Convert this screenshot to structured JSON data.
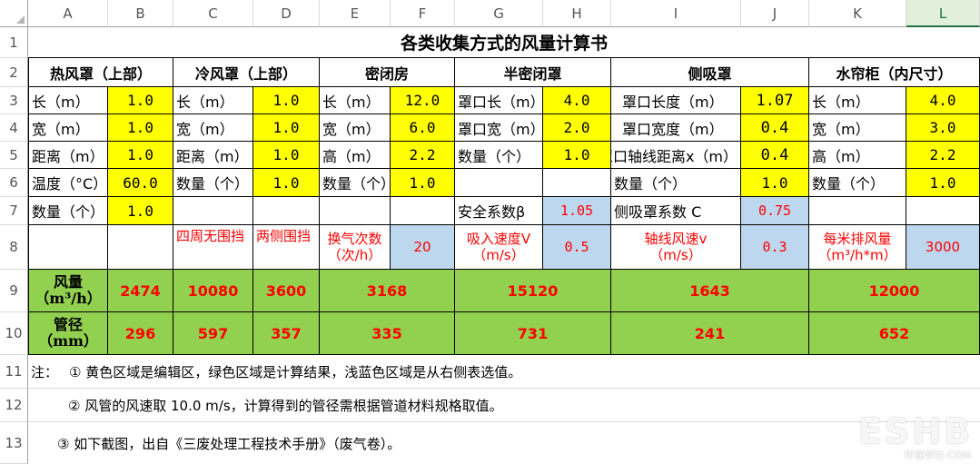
{
  "columns": [
    "A",
    "B",
    "C",
    "D",
    "E",
    "F",
    "G",
    "H",
    "I",
    "J",
    "K",
    "L"
  ],
  "rows": [
    "1",
    "2",
    "3",
    "4",
    "5",
    "6",
    "7",
    "8",
    "9",
    "10",
    "11",
    "12",
    "13"
  ],
  "selected_column": "L",
  "title": "各类收集方式的风量计算书",
  "sections": {
    "hot_hood": "热风罩（上部）",
    "cold_hood": "冷风罩（上部）",
    "closed_room": "密闭房",
    "semi_closed": "半密闭罩",
    "side_suction": "侧吸罩",
    "water_curtain": "水帘柜（内尺寸）"
  },
  "hot_hood": {
    "length_label": "长（m）",
    "length": "1.0",
    "width_label": "宽（m）",
    "width": "1.0",
    "distance_label": "距离（m）",
    "distance": "1.0",
    "temp_label": "温度（°C）",
    "temp": "60.0",
    "count_label": "数量（个）",
    "count": "1.0"
  },
  "cold_hood": {
    "length_label": "长（m）",
    "length": "1.0",
    "width_label": "宽（m）",
    "width": "1.0",
    "distance_label": "距离（m）",
    "distance": "1.0",
    "count_label": "数量（个）",
    "count": "1.0",
    "note_four_sides": "四周无围挡",
    "note_two_sides": "两侧围挡"
  },
  "closed_room": {
    "length_label": "长（m）",
    "length": "12.0",
    "width_label": "宽（m）",
    "width": "6.0",
    "height_label": "高（m）",
    "height": "2.2",
    "count_label": "数量（个）",
    "count": "1.0",
    "air_change_label": "换气次数（次/h）",
    "air_change": "20"
  },
  "semi_closed": {
    "length_label": "罩口长（m）",
    "length": "4.0",
    "width_label": "罩口宽（m）",
    "width": "2.0",
    "count_label": "数量（个）",
    "count": "1.0",
    "safety_label": "安全系数β",
    "safety": "1.05",
    "velocity_label": "吸入速度V（m/s）",
    "velocity": "0.5"
  },
  "side_suction": {
    "length_label": "罩口长度（m）",
    "length": "1.07",
    "width_label": "罩口宽度（m）",
    "width": "0.4",
    "axis_label": "罩口轴线距离x（m）",
    "axis": "0.4",
    "count_label": "数量（个）",
    "count": "1.0",
    "coef_label": "侧吸罩系数 C",
    "coef": "0.75",
    "axis_velocity_label": "轴线风速v（m/s）",
    "axis_velocity": "0.3"
  },
  "water_curtain": {
    "length_label": "长（m）",
    "length": "4.0",
    "width_label": "宽（m）",
    "width": "3.0",
    "height_label": "高（m）",
    "height": "2.2",
    "count_label": "数量（个）",
    "count": "1.0",
    "per_meter_label": "每米排风量（m³/h*m）",
    "per_meter": "3000"
  },
  "results": {
    "airflow_label": "风量（m³/h）",
    "duct_label": "管径（mm）",
    "airflow": [
      "2474",
      "10080",
      "3600",
      "3168",
      "15120",
      "1643",
      "12000"
    ],
    "duct": [
      "296",
      "597",
      "357",
      "335",
      "731",
      "241",
      "652"
    ]
  },
  "notes": {
    "prefix": "注：",
    "note1": "① 黄色区域是编辑区，绿色区域是计算结果，浅蓝色区域是从右侧表选值。",
    "note2": "② 风管的风速取 10.0 m/s，计算得到的管径需根据管道材料规格取值。",
    "note3": "③ 如下截图，出自《三废处理工程技术手册》（废气卷）。"
  },
  "watermark": {
    "main": "ESHB",
    "sub": "环保学社·COM"
  },
  "colors": {
    "yellow": "#ffff00",
    "green": "#92d050",
    "light_blue": "#bdd7ee",
    "red_text": "#ff0000"
  }
}
